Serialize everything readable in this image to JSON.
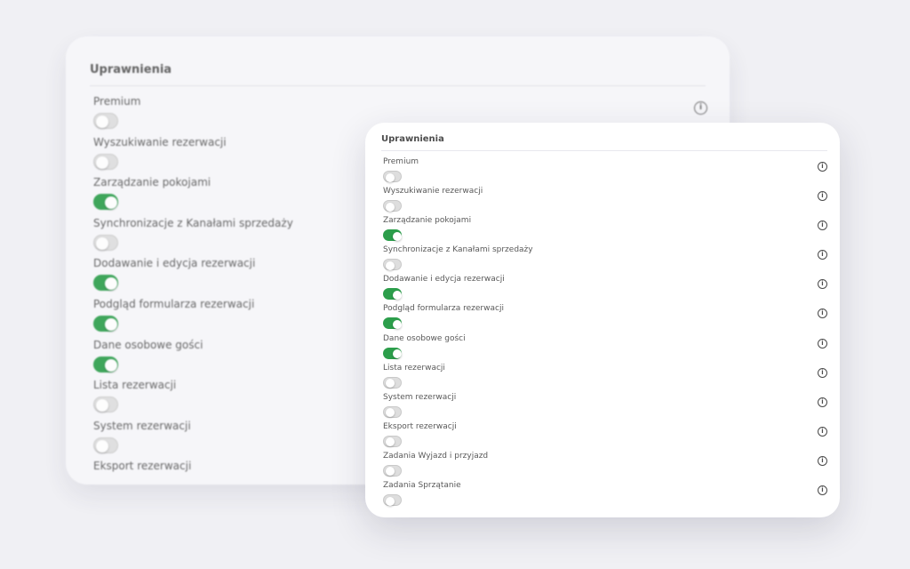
{
  "title": "Uprawnienia",
  "colors": {
    "toggle_on": "#2c9e4b",
    "toggle_off": "#dedede",
    "text": "#595959"
  },
  "icons": {
    "info": "info-icon",
    "info_glyph": "i"
  },
  "back_permissions": [
    {
      "label": "Premium",
      "enabled": false
    },
    {
      "label": "Wyszukiwanie rezerwacji",
      "enabled": false
    },
    {
      "label": "Zarządzanie pokojami",
      "enabled": true
    },
    {
      "label": "Synchronizacje z Kanałami sprzedaży",
      "enabled": false
    },
    {
      "label": "Dodawanie i edycja rezerwacji",
      "enabled": true
    },
    {
      "label": "Podgląd formularza rezerwacji",
      "enabled": true
    },
    {
      "label": "Dane osobowe gości",
      "enabled": true
    },
    {
      "label": "Lista rezerwacji",
      "enabled": false
    },
    {
      "label": "System rezerwacji",
      "enabled": false
    },
    {
      "label": "Eksport rezerwacji",
      "enabled": null
    }
  ],
  "permissions": [
    {
      "label": "Premium",
      "enabled": false
    },
    {
      "label": "Wyszukiwanie rezerwacji",
      "enabled": false
    },
    {
      "label": "Zarządzanie pokojami",
      "enabled": true
    },
    {
      "label": "Synchronizacje z Kanałami sprzedaży",
      "enabled": false
    },
    {
      "label": "Dodawanie i edycja rezerwacji",
      "enabled": true
    },
    {
      "label": "Podgląd formularza rezerwacji",
      "enabled": true
    },
    {
      "label": "Dane osobowe gości",
      "enabled": true
    },
    {
      "label": "Lista rezerwacji",
      "enabled": false
    },
    {
      "label": "System rezerwacji",
      "enabled": false
    },
    {
      "label": "Eksport rezerwacji",
      "enabled": false
    },
    {
      "label": "Zadania Wyjazd i przyjazd",
      "enabled": false
    },
    {
      "label": "Zadania Sprzątanie",
      "enabled": false
    }
  ]
}
